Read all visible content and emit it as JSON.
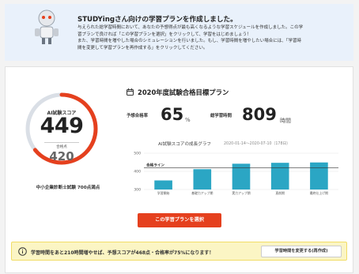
{
  "banner": {
    "title": "STUDYingさん向けの学習プランを作成しました。",
    "lines": [
      "与えられた総学習時間において、あなたの予想得点が最も高くなるような学習スケジュールを作成しました。この学",
      "習プランで良ければ「この学習プランを選択」をクリックして、学習をはじめましょう！",
      "また、学習時間を増やした場合のシミュレーションを行いました。もし、学習時間を増やしたい場合には、「学習時",
      "間を変更して学習プランを再作成する」をクリックしてください。"
    ]
  },
  "score_card": {
    "label": "AI試験スコア",
    "score": "449",
    "pass_label": "合格点",
    "pass_score": "420",
    "exam_name": "中小企業診断士試験 700点満点",
    "max_score": 700,
    "score_value": 449,
    "pass_value": 420
  },
  "plan": {
    "title": "2020年度試験合格目標プラン",
    "pass_rate_label": "予想合格率",
    "pass_rate": "65",
    "pass_rate_unit": "%",
    "total_hours_label": "総学習時間",
    "total_hours": "809",
    "total_hours_unit": "時間",
    "graph_title": "AI試験スコアの成長グラフ",
    "graph_range": "2020-01-14〜2020-07-10（178日）"
  },
  "chart_data": {
    "type": "bar",
    "title": "AI試験スコアの成長グラフ",
    "categories": [
      "学習開始",
      "基礎力アップ期",
      "実力アップ期",
      "直前期",
      "最終仕上げ期"
    ],
    "values": [
      350,
      412,
      442,
      447,
      449
    ],
    "ylim": [
      300,
      500
    ],
    "yticks": [
      "500",
      "400",
      "300"
    ],
    "reference_line": {
      "label": "合格ライン",
      "value": 420
    },
    "grid": true,
    "bar_color": "#2ba6c4"
  },
  "cta": {
    "label": "この学習プランを選択"
  },
  "notice": {
    "text": "学習時間をあと210時間増やせば、予想スコアが468点・合格率が75%になります！",
    "button_label": "学習時間を変更する(再作成)",
    "icon": "info-icon"
  },
  "colors": {
    "accent": "#e5401e",
    "gauge_gray": "#dadfe6",
    "bar": "#2ba6c4",
    "notice_bg": "#fbf5c4"
  }
}
